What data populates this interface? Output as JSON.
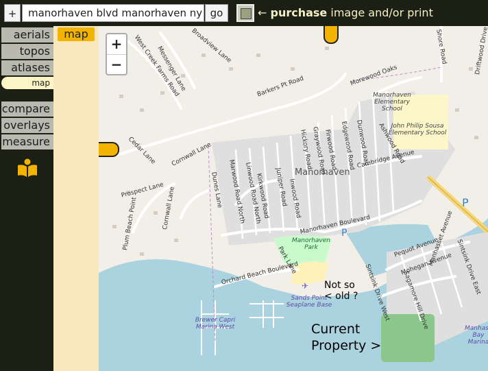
{
  "topbar": {
    "plus_label": "+",
    "search_value": "manorhaven blvd manorhaven ny",
    "go_label": "go",
    "purchase_bold": "purchase",
    "purchase_arrow": "←",
    "purchase_rest": "image and/or print"
  },
  "sidebar": {
    "tabs": [
      "aerials",
      "topos",
      "atlases"
    ],
    "selected_sub": "map",
    "tools": [
      "compare",
      "overlays",
      "measure"
    ]
  },
  "map_tab_label": "map",
  "zoom": {
    "in": "+",
    "out": "−"
  },
  "map": {
    "place": "Manorhaven",
    "streets": [
      "Barkers Pt Road",
      "Messenger Lane",
      "Cornwall Lane",
      "Cedar Lane",
      "Prospect Lane",
      "Cornwall Lane",
      "Plum Beach Point",
      "Dunes Lane",
      "Morewood Oaks",
      "Manorhaven Boulevard",
      "Cambridge Avenue",
      "Orchard Beach Boulevard",
      "Park Lane",
      "Pequot Avenue",
      "Mohegan Avenue",
      "Sintsink Drive West",
      "Sintsink Drive East",
      "Ashwood Road",
      "Edgewood Road",
      "Dunwood Road",
      "Firwood Road",
      "Graywood Road",
      "Hickory Road",
      "Inwood Road",
      "Juniper Road",
      "Kirkwood Road",
      "Linwood Road North",
      "Marwood Road North",
      "Manhasset Avenue",
      "Sagamore Hill Drive",
      "Driftwood Drive",
      "West Creek Farms Road",
      "Shore Road",
      "Broadview Lane"
    ],
    "schools": [
      "Manorhaven Elementary School",
      "John Philip Sousa Elementary School"
    ],
    "park": "Manorhaven Park",
    "seaplane": "Sands Point Seaplane Base",
    "marina": "Brewer Capri Marina West",
    "bay": "Manhasset Bay Marina",
    "parking": "P"
  },
  "annotations": {
    "not_so_old": "Not so\n< old ?",
    "current": "Current\nProperty >"
  },
  "colors": {
    "accent": "#f2b400",
    "bg": "#1c1f13",
    "water": "#aad3df",
    "park": "#c8facc"
  }
}
